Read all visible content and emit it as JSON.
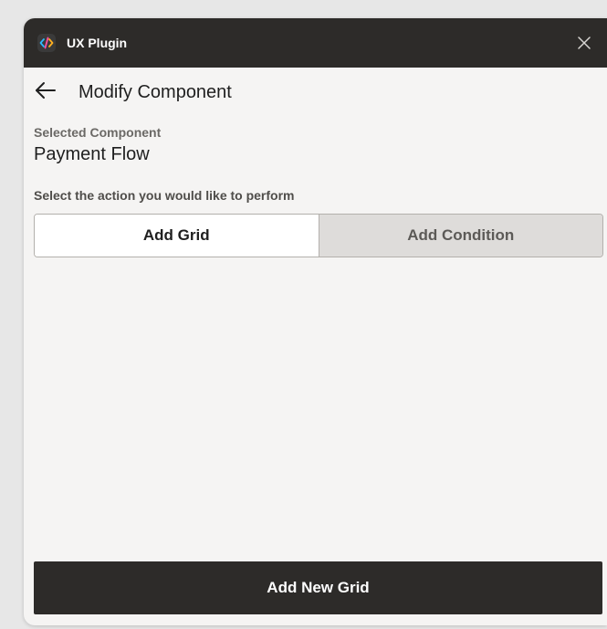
{
  "window": {
    "title": "UX Plugin"
  },
  "header": {
    "title": "Modify Component"
  },
  "selection": {
    "label": "Selected Component",
    "value": "Payment Flow"
  },
  "action": {
    "prompt": "Select the action you would like to perform",
    "options": [
      {
        "label": "Add Grid",
        "selected": true
      },
      {
        "label": "Add Condition",
        "selected": false
      }
    ]
  },
  "footer": {
    "primary_label": "Add New Grid"
  },
  "icons": {
    "app": "code-plugin-icon",
    "close": "close-icon",
    "back": "arrow-left-icon"
  },
  "colors": {
    "titlebar": "#2d2b29",
    "panel": "#f5f4f3",
    "segment_active": "#ffffff",
    "segment_inactive": "#dedcda",
    "primary_button": "#2d2b29"
  }
}
